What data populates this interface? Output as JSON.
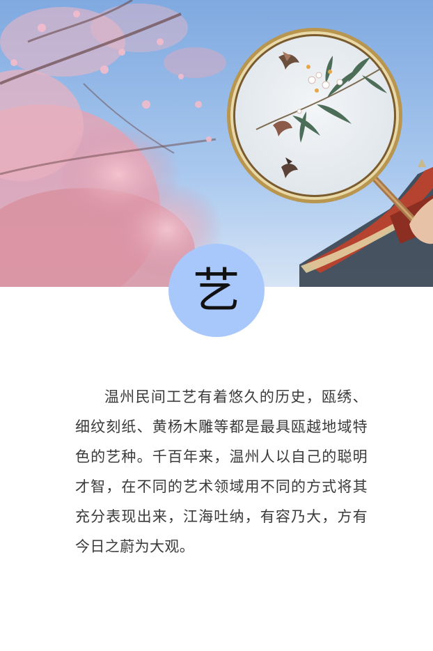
{
  "badge": {
    "character": "艺",
    "color": "#a8c7fb"
  },
  "photo": {
    "subject": "embroidered-round-fan-icon",
    "sky_color": "#8fb6e6",
    "blossom_color": "#e9a9b9",
    "roof_color": "#b5432f"
  },
  "article": {
    "paragraph": "温州民间工艺有着悠久的历史，瓯绣、细纹刻纸、黄杨木雕等都是最具瓯越地域特色的艺种。千百年来，温州人以自己的聪明才智，在不同的艺术领域用不同的方式将其充分表现出来，江海吐纳，有容乃大，方有今日之蔚为大观。"
  }
}
